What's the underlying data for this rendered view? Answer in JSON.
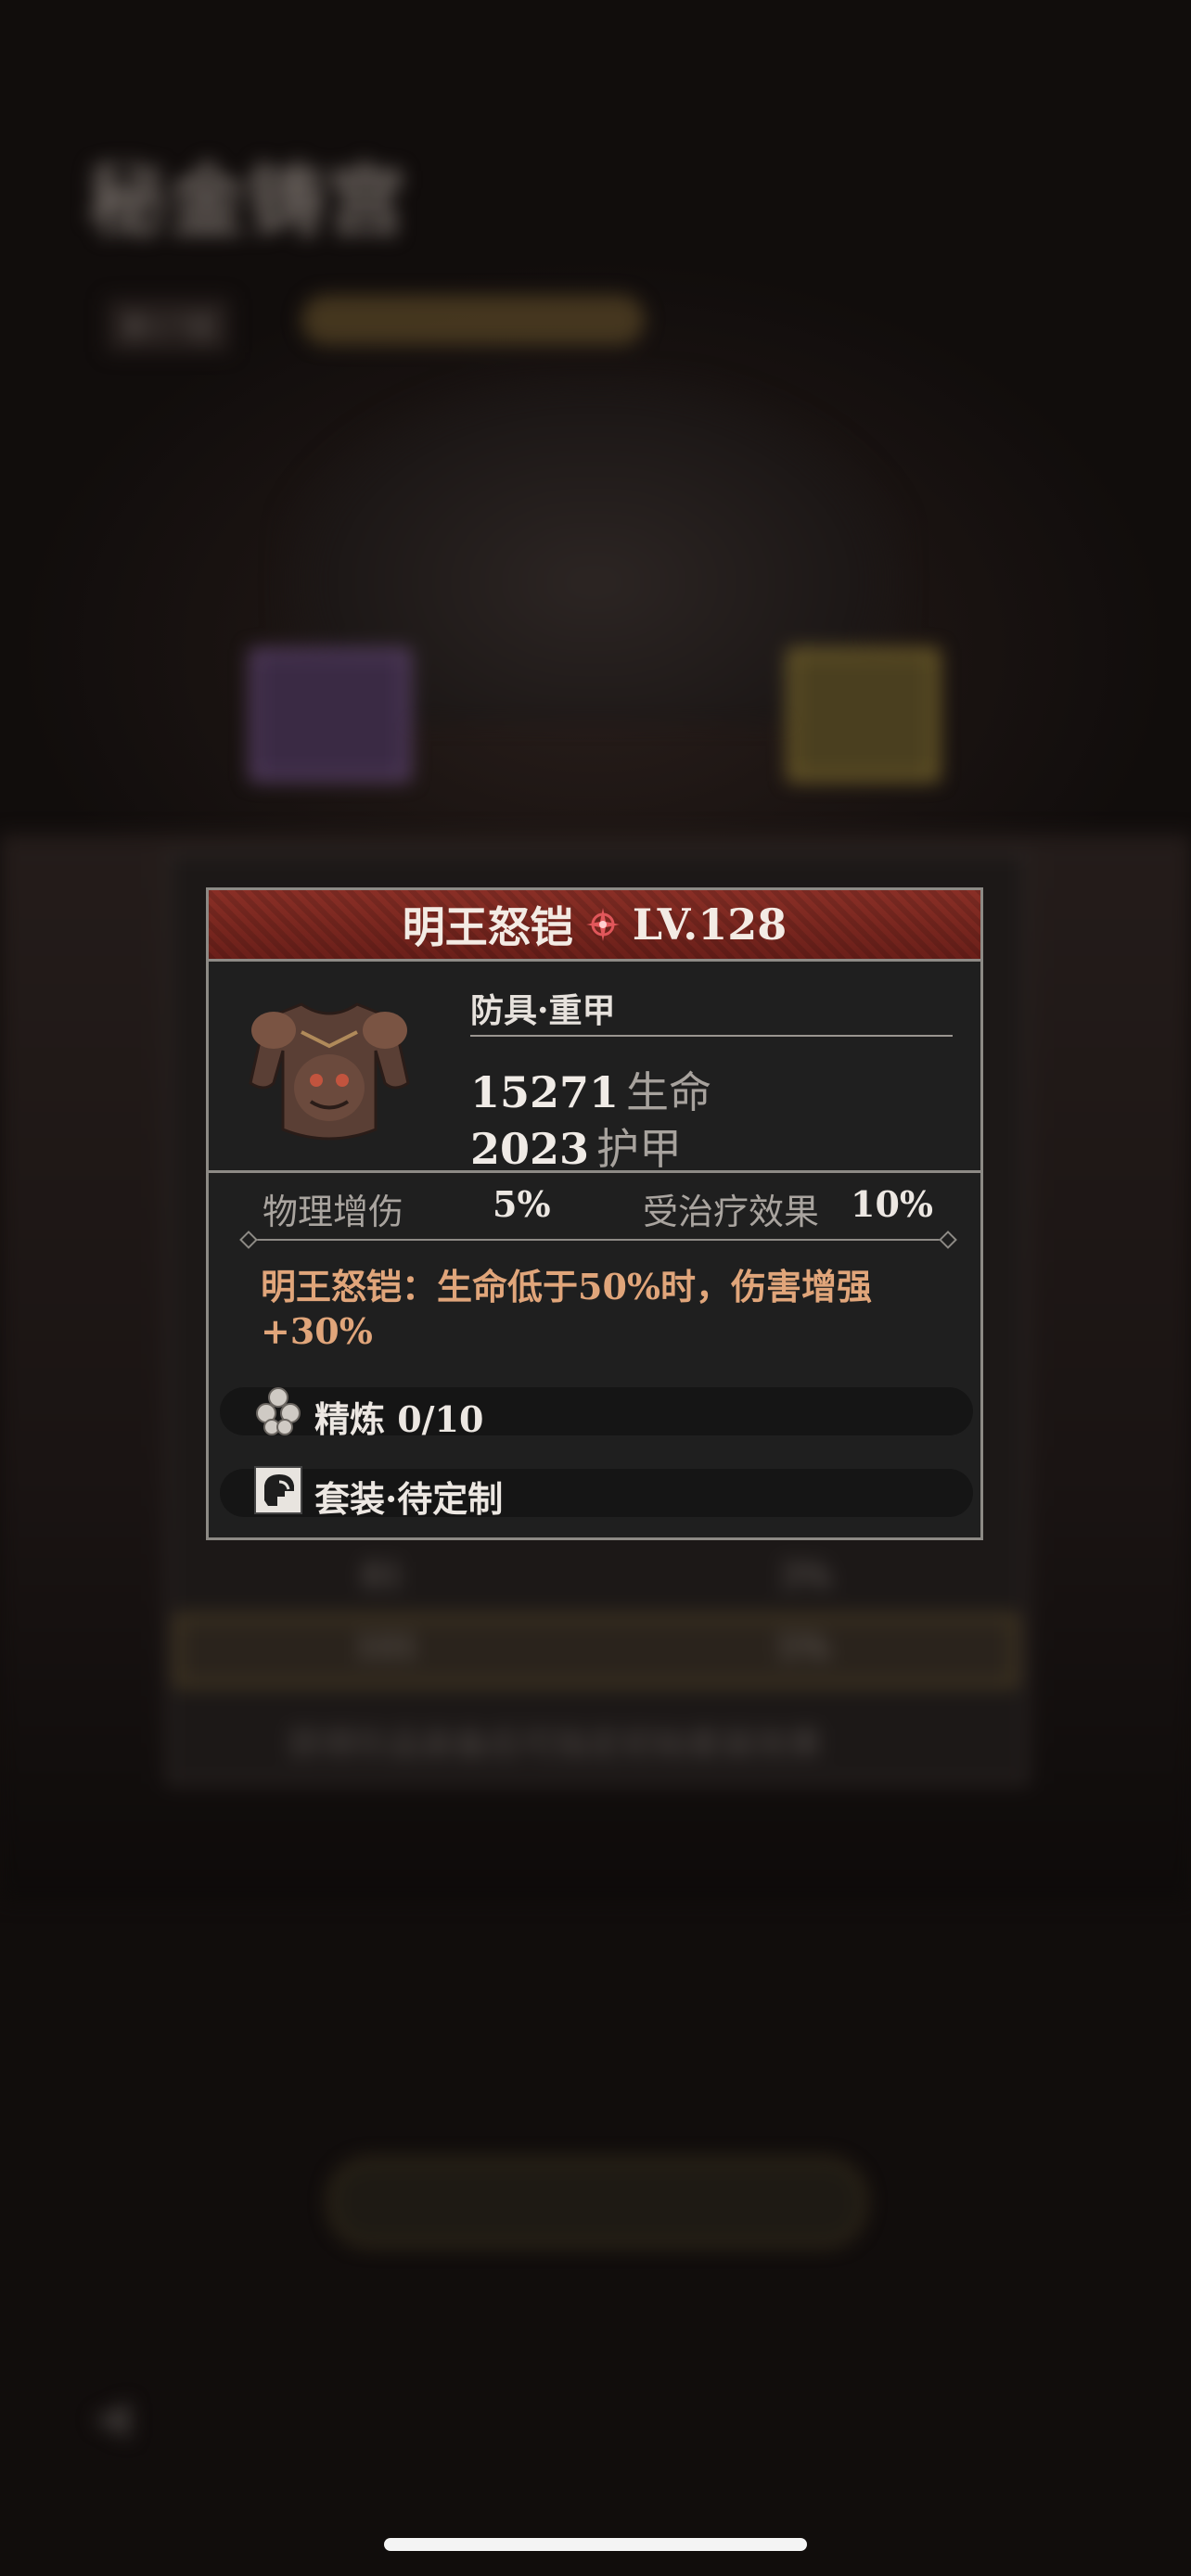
{
  "background": {
    "title": "秘金铸宫",
    "subtitle": "",
    "floor": "第17层",
    "banner": "",
    "table_rows": [
      {
        "col1": "81",
        "col2": "3%"
      },
      {
        "col1": "101",
        "col2": "5%"
      }
    ],
    "note": "获得珍品装备后可指定初始套装效果",
    "main_button": "",
    "nav_items": [
      "",
      "",
      "",
      ""
    ]
  },
  "item": {
    "name": "明王怒铠",
    "level": "LV.128",
    "type": "防具·重甲",
    "stats": [
      {
        "value": "15271",
        "label": "生命"
      },
      {
        "value": "2023",
        "label": "护甲"
      }
    ],
    "attributes": [
      {
        "label": "物理增伤",
        "value": "5%"
      },
      {
        "label": "受治疗效果",
        "value": "10%"
      }
    ],
    "effect": "明王怒铠：生命低于50%时，伤害增强+30%",
    "refine": "精炼 0/10",
    "set": "套装·待定制",
    "icons": {
      "header_gem": "red-gem-icon",
      "item": "heavy-armor-icon",
      "refine": "refine-orbs-icon",
      "set": "set-helmet-icon"
    },
    "colors": {
      "header": "#7a2720",
      "effect_text": "#e0a57a",
      "border": "#8d8a85"
    }
  }
}
